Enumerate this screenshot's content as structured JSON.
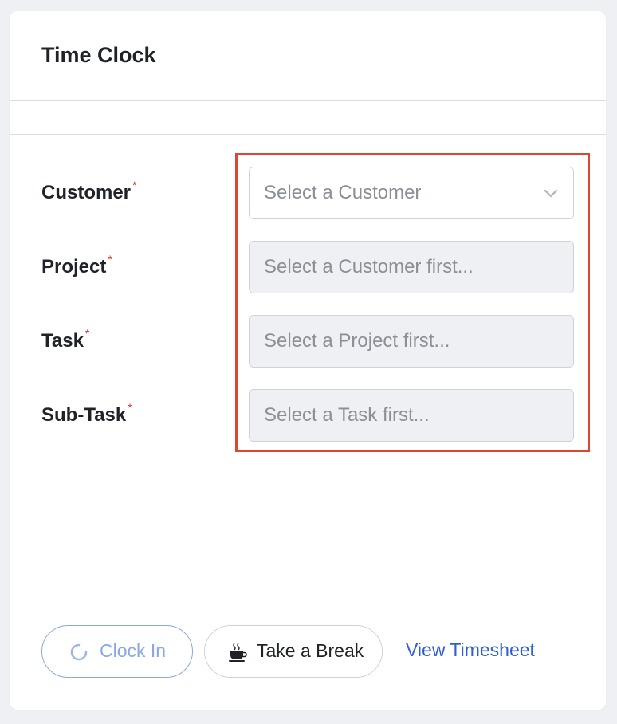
{
  "card": {
    "title": "Time Clock"
  },
  "fields": [
    {
      "label": "Customer",
      "value": "Select a Customer",
      "disabled": false
    },
    {
      "label": "Project",
      "value": "Select a Customer first...",
      "disabled": true
    },
    {
      "label": "Task",
      "value": "Select a Project first...",
      "disabled": true
    },
    {
      "label": "Sub-Task",
      "value": "Select a Task first...",
      "disabled": true
    }
  ],
  "required_marker": "*",
  "actions": {
    "clock_in": "Clock In",
    "take_break": "Take a Break",
    "view_timesheet": "View Timesheet"
  },
  "colors": {
    "highlight_border": "#e0452f",
    "required": "#d93025",
    "link": "#2f5fd0",
    "clock_in_accent": "#8aa7e6"
  }
}
